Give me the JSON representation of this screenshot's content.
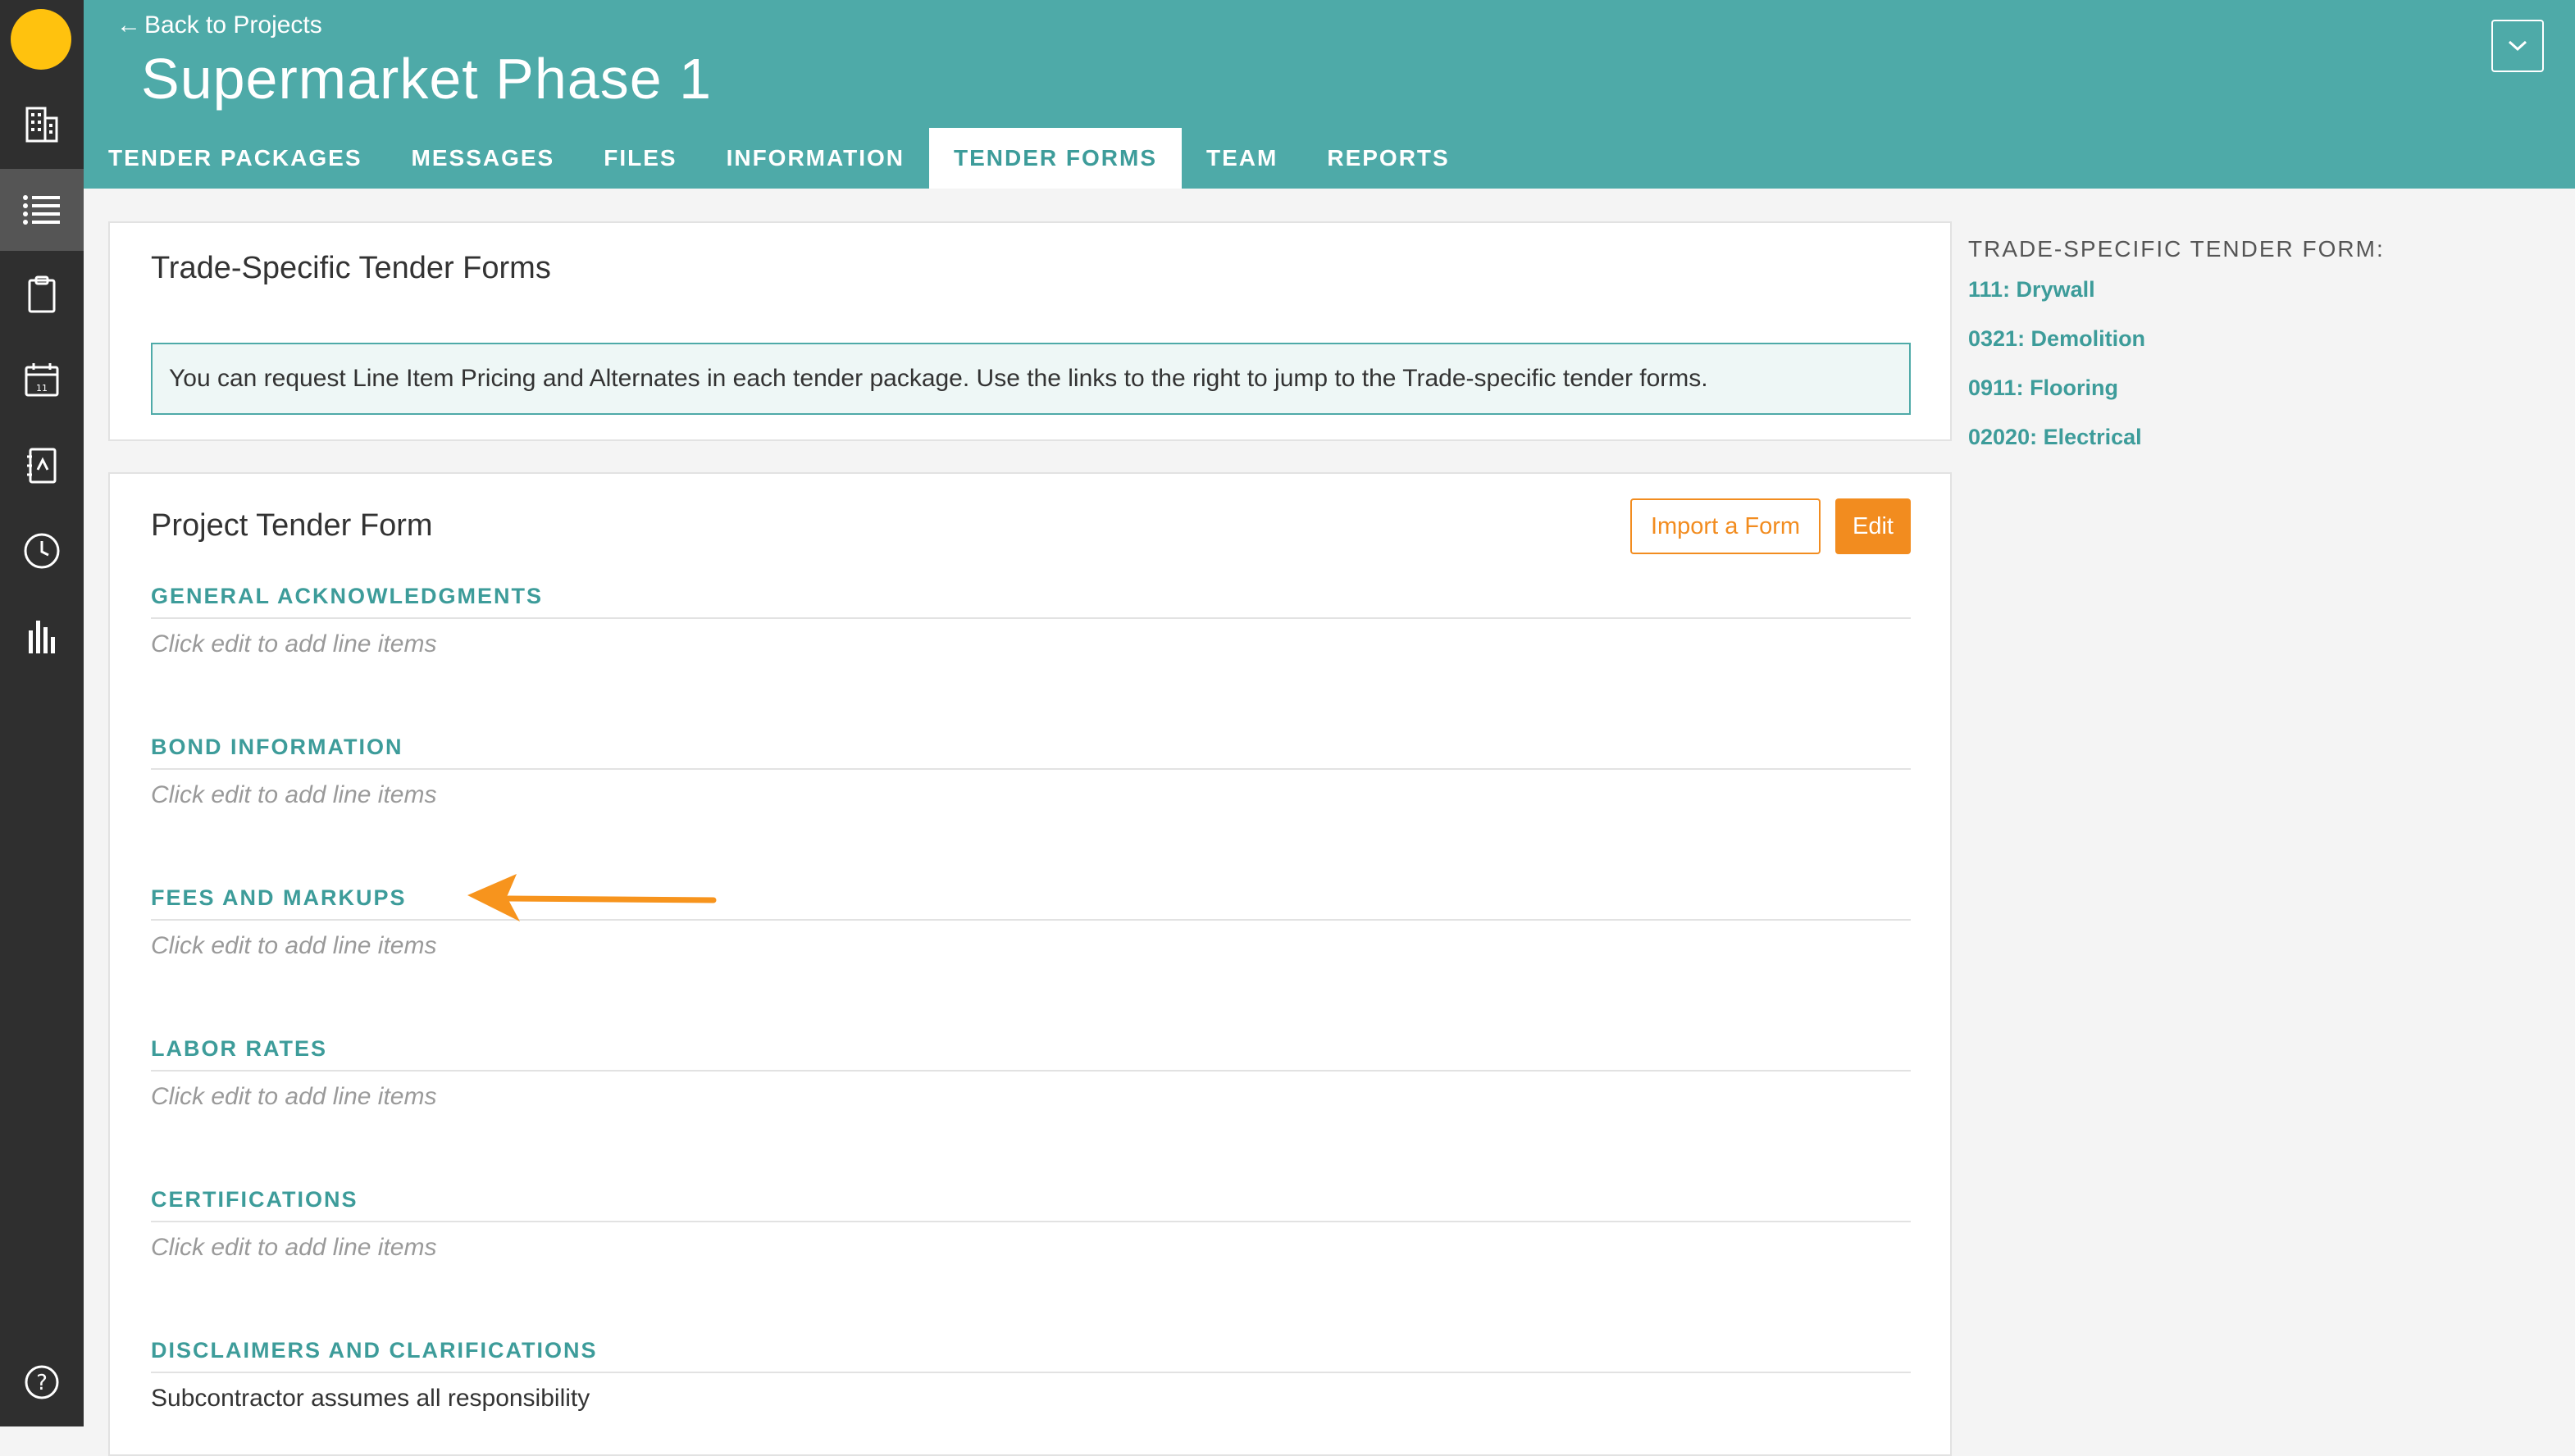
{
  "header": {
    "back_label": "Back to Projects",
    "project_title": "Supermarket Phase 1",
    "accent_color": "#4eaaa8"
  },
  "tabs": [
    {
      "label": "TENDER PACKAGES",
      "active": false
    },
    {
      "label": "MESSAGES",
      "active": false
    },
    {
      "label": "FILES",
      "active": false
    },
    {
      "label": "INFORMATION",
      "active": false
    },
    {
      "label": "TENDER FORMS",
      "active": true
    },
    {
      "label": "TEAM",
      "active": false
    },
    {
      "label": "REPORTS",
      "active": false
    }
  ],
  "sidebar_icons": [
    "building-icon",
    "list-icon",
    "clipboard-icon",
    "calendar-icon",
    "contacts-book-icon",
    "clock-icon",
    "bar-chart-icon",
    "help-icon"
  ],
  "trade_panel": {
    "title": "Trade-Specific Tender Forms",
    "info": "You can request Line Item Pricing and Alternates in each tender package. Use the links to the right to jump to the Trade-specific tender forms."
  },
  "project_panel": {
    "title": "Project Tender Form",
    "import_label": "Import a Form",
    "edit_label": "Edit",
    "sections": [
      {
        "heading": "GENERAL ACKNOWLEDGMENTS",
        "body": "Click edit to add line items"
      },
      {
        "heading": "BOND INFORMATION",
        "body": "Click edit to add line items"
      },
      {
        "heading": "FEES AND MARKUPS",
        "body": "Click edit to add line items"
      },
      {
        "heading": "LABOR RATES",
        "body": "Click edit to add line items"
      },
      {
        "heading": "CERTIFICATIONS",
        "body": "Click edit to add line items"
      },
      {
        "heading": "DISCLAIMERS AND CLARIFICATIONS",
        "body": "Subcontractor assumes all responsibility"
      }
    ]
  },
  "right_sidebar": {
    "title": "TRADE-SPECIFIC TENDER FORM:",
    "links": [
      "111: Drywall",
      "0321: Demolition",
      "0911: Flooring",
      "02020: Electrical"
    ]
  },
  "colors": {
    "brand_orange": "#f28c1f",
    "logo_yellow": "#ffc20e",
    "sidebar_bg": "#2f2f2f"
  }
}
